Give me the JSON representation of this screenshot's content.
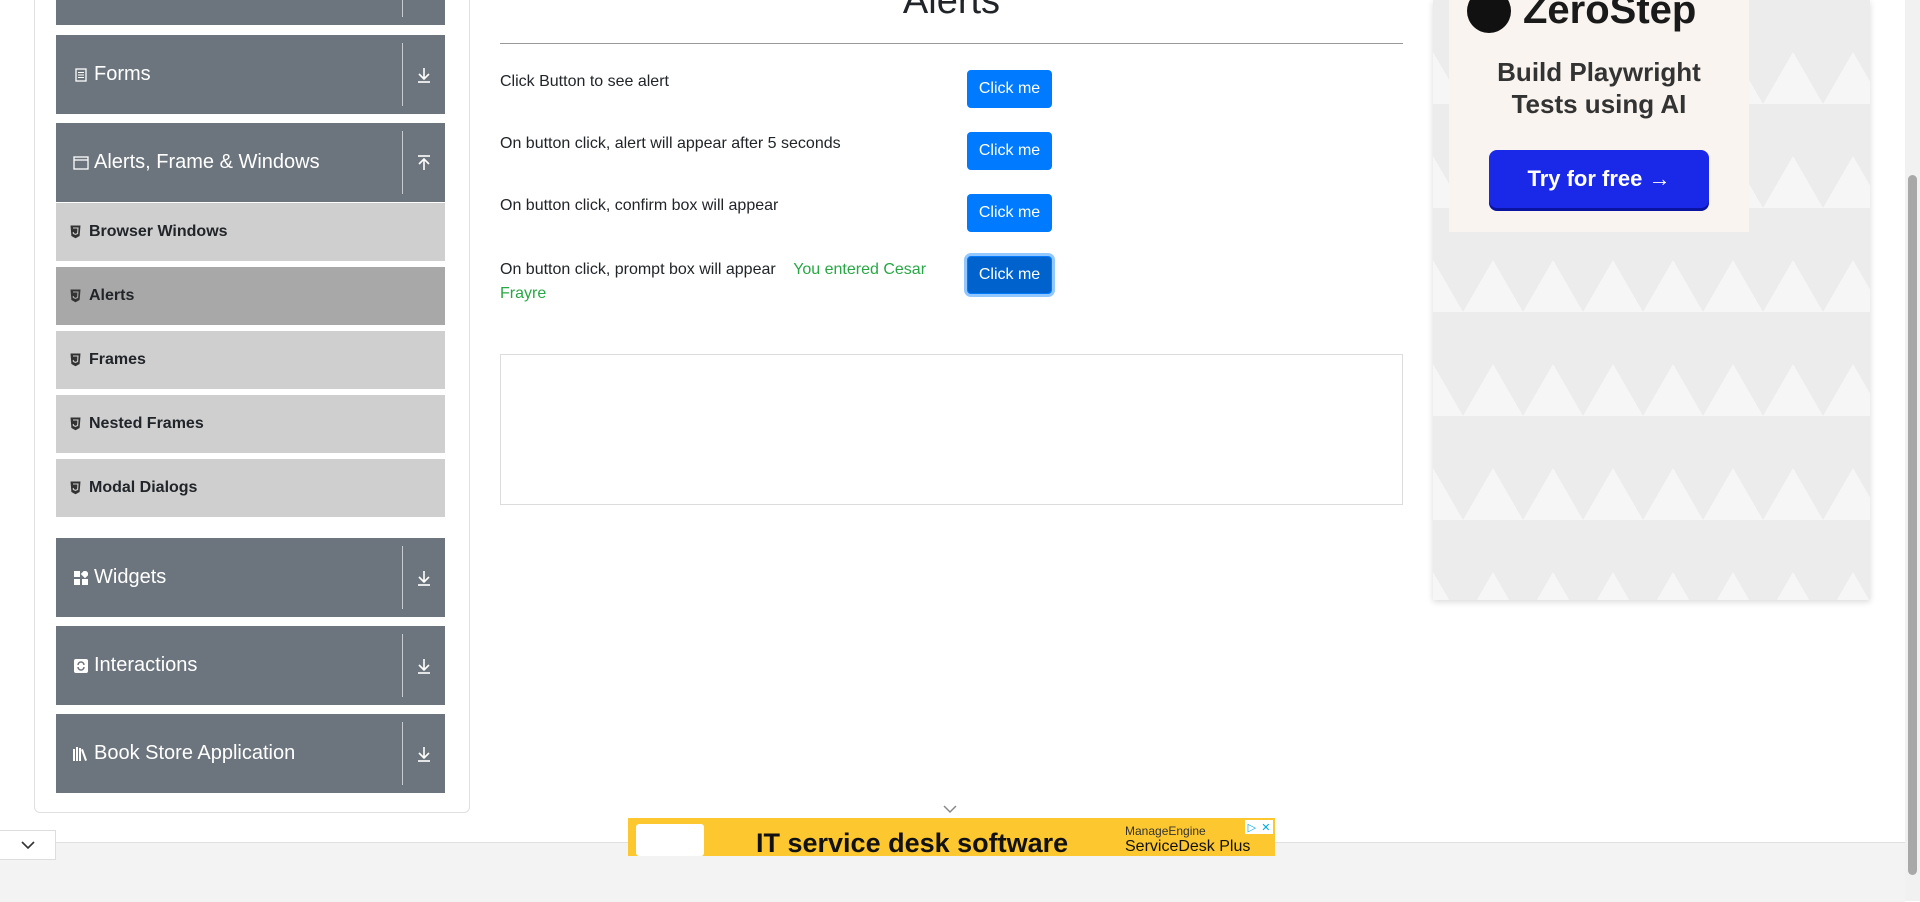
{
  "sidebar": {
    "groups": [
      {
        "label": "Forms",
        "icon": "form-icon",
        "arrow": "download-arrow-icon"
      },
      {
        "label": "Alerts, Frame & Windows",
        "icon": "window-icon",
        "arrow": "upload-arrow-icon"
      },
      {
        "label": "Widgets",
        "icon": "widgets-icon",
        "arrow": "download-arrow-icon"
      },
      {
        "label": "Interactions",
        "icon": "interactions-icon",
        "arrow": "download-arrow-icon"
      },
      {
        "label": "Book Store Application",
        "icon": "book-icon",
        "arrow": "download-arrow-icon"
      }
    ],
    "items": [
      {
        "label": "Browser Windows",
        "active": false
      },
      {
        "label": "Alerts",
        "active": true
      },
      {
        "label": "Frames",
        "active": false
      },
      {
        "label": "Nested Frames",
        "active": false
      },
      {
        "label": "Modal Dialogs",
        "active": false
      }
    ]
  },
  "main": {
    "title": "Alerts",
    "rows": [
      {
        "label": "Click Button to see alert",
        "button": "Click me"
      },
      {
        "label": "On button click, alert will appear after 5 seconds",
        "button": "Click me"
      },
      {
        "label": "On button click, confirm box will appear",
        "button": "Click me"
      },
      {
        "label": "On button click, prompt box will appear",
        "button": "Click me"
      }
    ],
    "prompt_result": "You entered Cesar Frayre"
  },
  "ad_right": {
    "brand": "ZeroStep",
    "headline_line1": "Build Playwright",
    "headline_line2": "Tests using AI",
    "cta": "Try for free →"
  },
  "ad_bottom": {
    "headline": "IT service desk software",
    "brand_top": "ManageEngine",
    "brand_bottom": "ServiceDesk Plus"
  },
  "colors": {
    "sidebar_header": "#6c757d",
    "sidebar_item": "#cfcfcf",
    "sidebar_item_active": "#a8a8a8",
    "primary_button": "#007bff",
    "result_text": "#28a745",
    "ad_cta": "#1a28e8",
    "ad_bottom_bg": "#fdc82f"
  }
}
